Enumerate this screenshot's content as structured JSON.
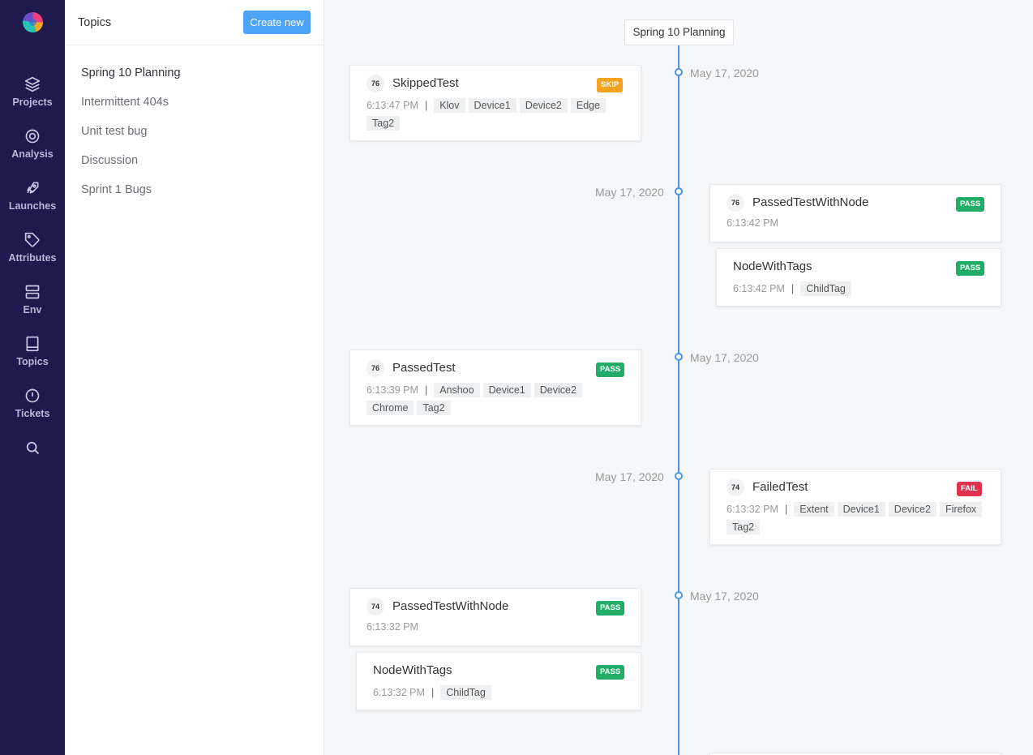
{
  "nav": {
    "items": [
      {
        "label": "Projects",
        "icon": "layers-icon"
      },
      {
        "label": "Analysis",
        "icon": "target-icon"
      },
      {
        "label": "Launches",
        "icon": "rocket-icon"
      },
      {
        "label": "Attributes",
        "icon": "tag-icon"
      },
      {
        "label": "Env",
        "icon": "server-icon"
      },
      {
        "label": "Topics",
        "icon": "book-icon"
      },
      {
        "label": "Tickets",
        "icon": "alert-circle-icon"
      }
    ],
    "search_icon": "search-icon"
  },
  "panel": {
    "title": "Topics",
    "create_label": "Create new",
    "topics": [
      "Spring 10 Planning",
      "Intermittent 404s",
      "Unit test bug",
      "Discussion",
      "Sprint 1 Bugs"
    ]
  },
  "timeline": {
    "title": "Spring 10 Planning",
    "entries": [
      {
        "date": "May 17, 2020",
        "id": "76",
        "name": "SkippedTest",
        "status": "SKIP",
        "time": "6:13:47 PM",
        "tags": [
          "Klov",
          "Device1",
          "Device2",
          "Edge",
          "Tag2"
        ]
      },
      {
        "date": "May 17, 2020",
        "id": "76",
        "name": "PassedTestWithNode",
        "status": "PASS",
        "time": "6:13:42 PM",
        "tags": [],
        "child": {
          "name": "NodeWithTags",
          "status": "PASS",
          "time": "6:13:42 PM",
          "tags": [
            "ChildTag"
          ]
        }
      },
      {
        "date": "May 17, 2020",
        "id": "76",
        "name": "PassedTest",
        "status": "PASS",
        "time": "6:13:39 PM",
        "tags": [
          "Anshoo",
          "Device1",
          "Device2",
          "Chrome",
          "Tag2"
        ]
      },
      {
        "date": "May 17, 2020",
        "id": "74",
        "name": "FailedTest",
        "status": "FAIL",
        "time": "6:13:32 PM",
        "tags": [
          "Extent",
          "Device1",
          "Device2",
          "Firefox",
          "Tag2"
        ]
      },
      {
        "date": "May 17, 2020",
        "id": "74",
        "name": "PassedTestWithNode",
        "status": "PASS",
        "time": "6:13:32 PM",
        "tags": [],
        "child": {
          "name": "NodeWithTags",
          "status": "PASS",
          "time": "6:13:32 PM",
          "tags": [
            "ChildTag"
          ]
        }
      }
    ]
  },
  "colors": {
    "nav_bg": "#1e1a4d",
    "accent": "#4da3f7",
    "pass": "#21ad68",
    "skip": "#f4a11d",
    "fail": "#e0324e",
    "timeline": "#4a94e6"
  }
}
